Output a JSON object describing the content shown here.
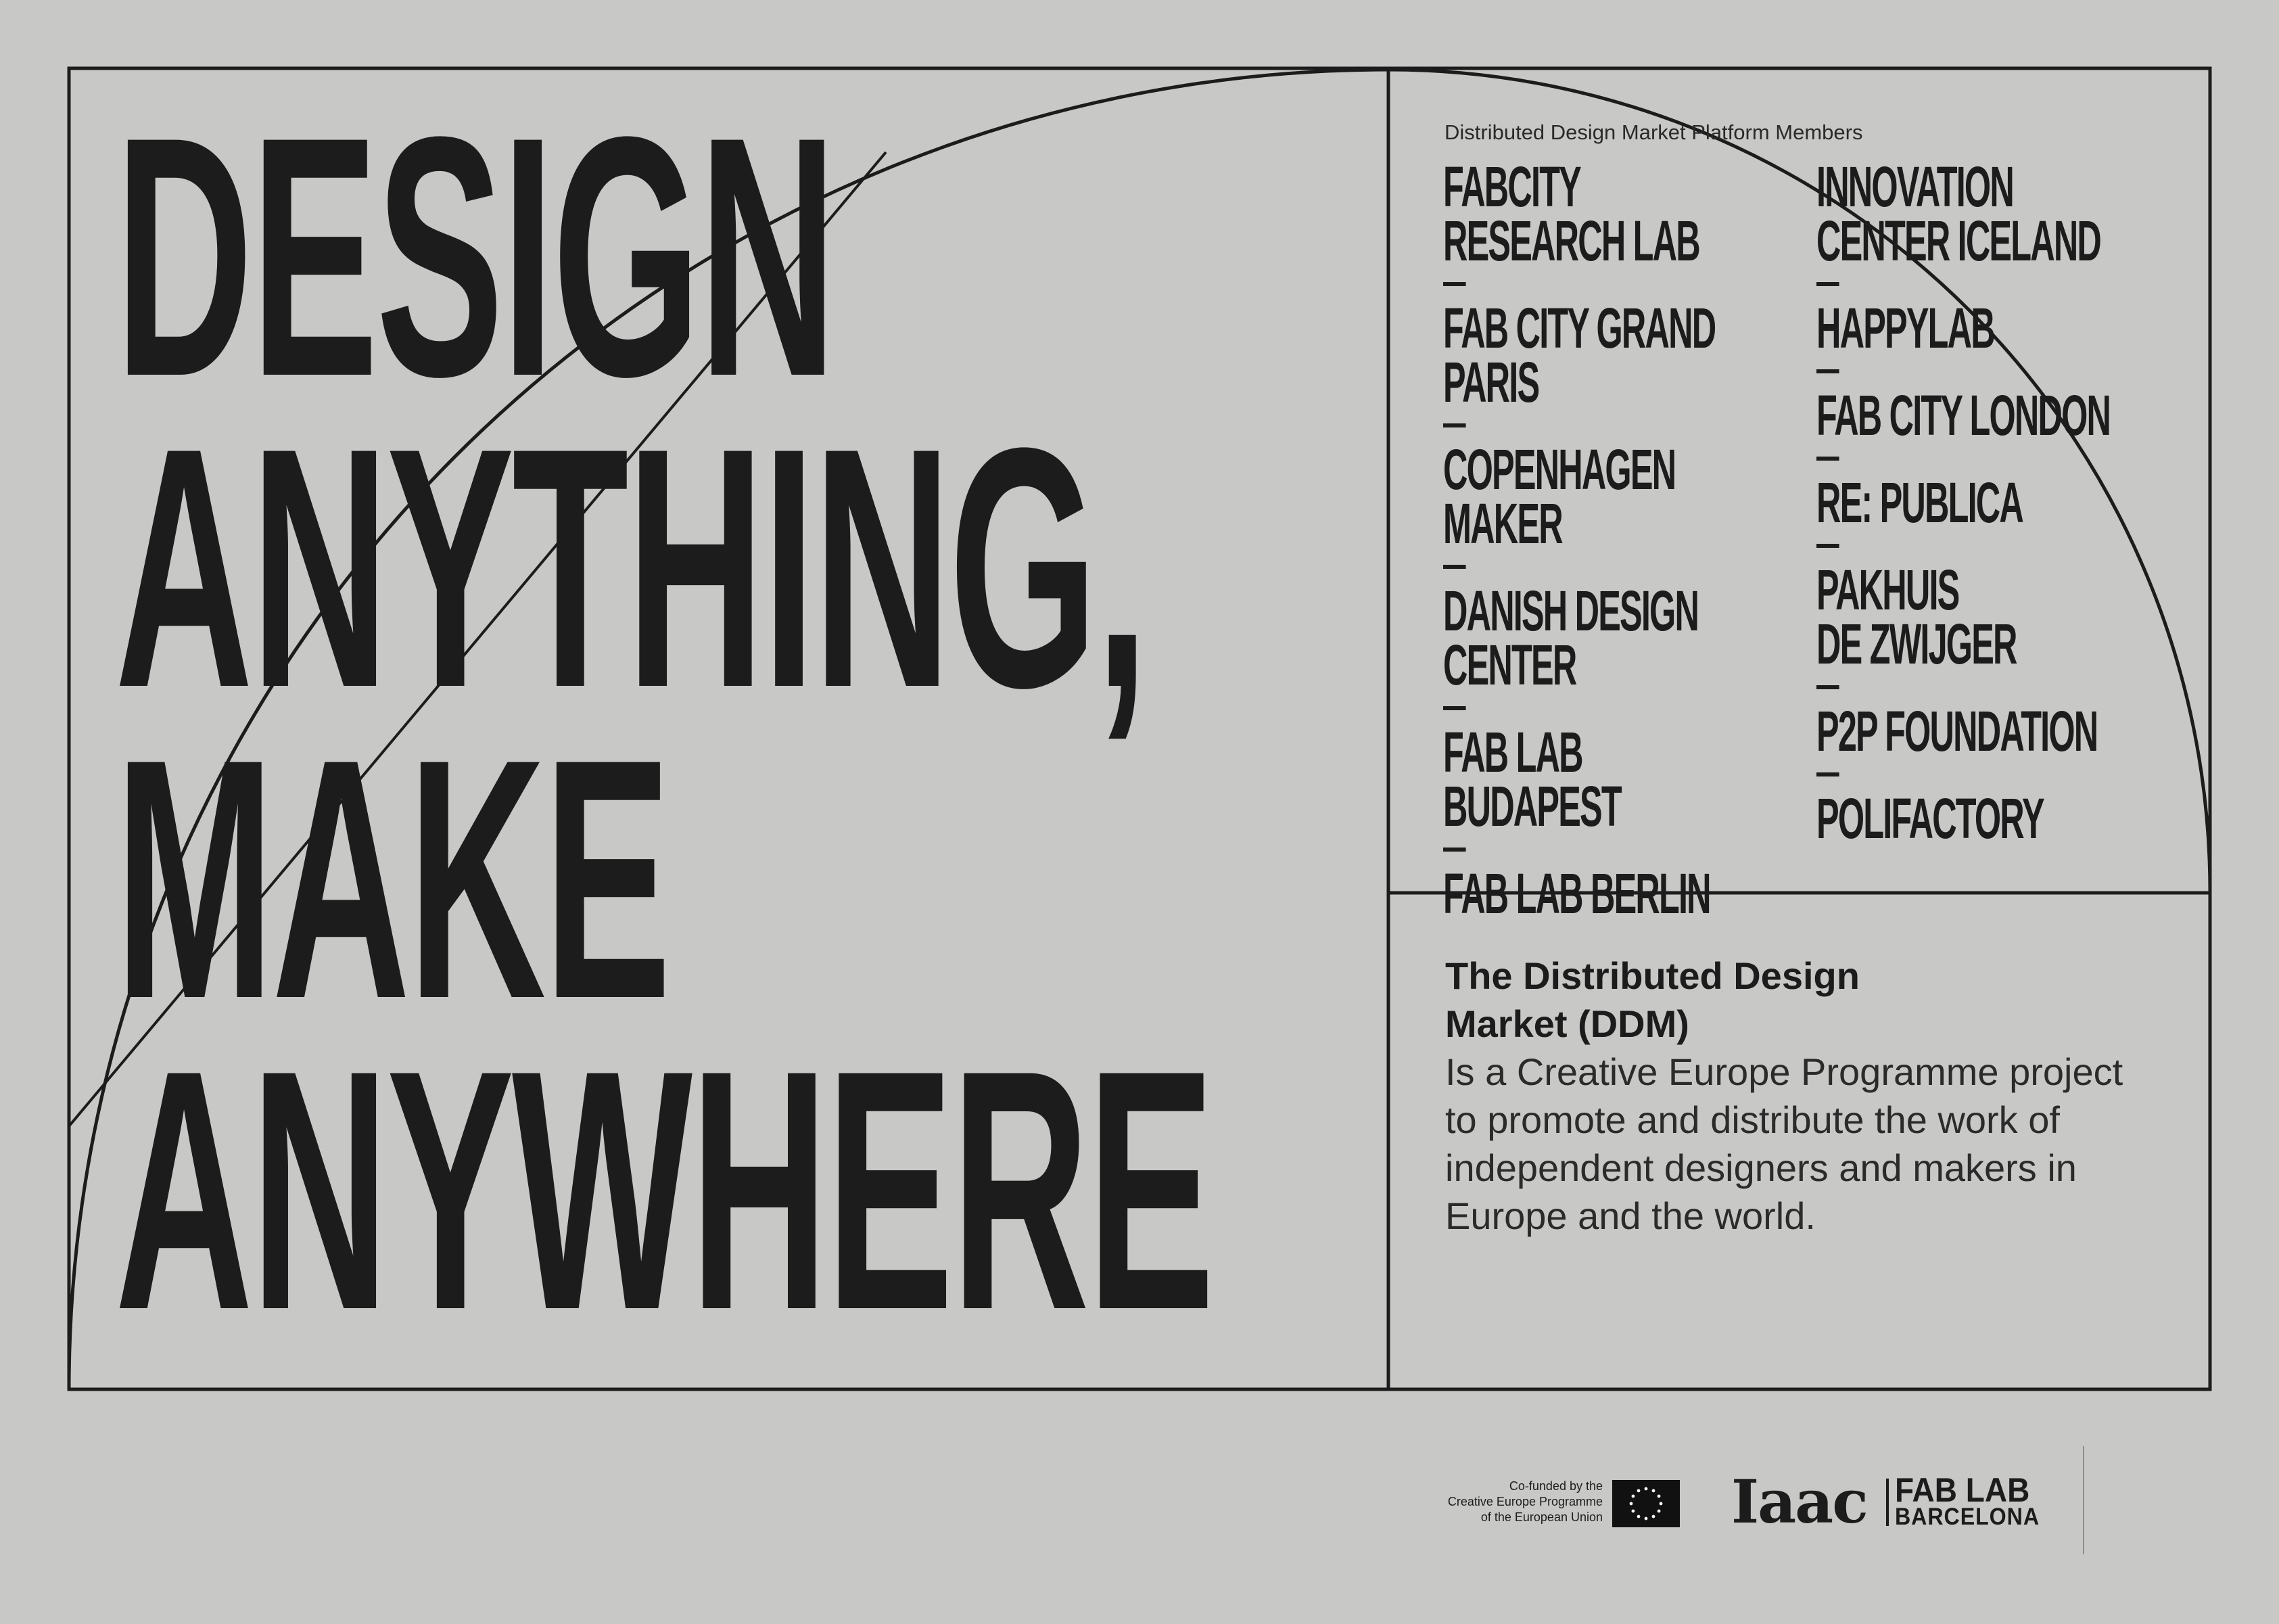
{
  "headline": {
    "lines": [
      "DESIGN",
      "ANYTHING,",
      "MAKE",
      "ANYWHERE"
    ]
  },
  "members": {
    "caption": "Distributed Design Market Platform Members",
    "column_1": [
      "FABCITY\nRESEARCH LAB",
      "FAB CITY GRAND PARIS",
      "COPENHAGEN\nMAKER",
      "DANISH DESIGN\nCENTER",
      "FAB LAB\nBUDAPEST",
      "FAB LAB BERLIN"
    ],
    "column_2": [
      "INNOVATION\nCENTER ICELAND",
      "HAPPYLAB",
      "FAB CITY LONDON",
      "RE: PUBLICA",
      "PAKHUIS\nDE ZWIJGER",
      "P2P FOUNDATION",
      "POLIFACTORY"
    ]
  },
  "about": {
    "title": "The Distributed Design\nMarket (DDM)",
    "body": "Is a Creative Europe Programme project to promote and distribute the work of independent designers and makers in Europe and the world."
  },
  "footer": {
    "cofunded": {
      "line_1": "Co-funded by the",
      "line_2": "Creative Europe Programme",
      "line_3": "of the European Union"
    },
    "iaac_logo": "Iaac",
    "fablab_line_1": "FAB LAB",
    "fablab_line_2": "BARCELONA"
  },
  "colors": {
    "background": "#c8c8c6",
    "ink": "#1d1c1c",
    "eu_star": "#f5f5f5"
  }
}
